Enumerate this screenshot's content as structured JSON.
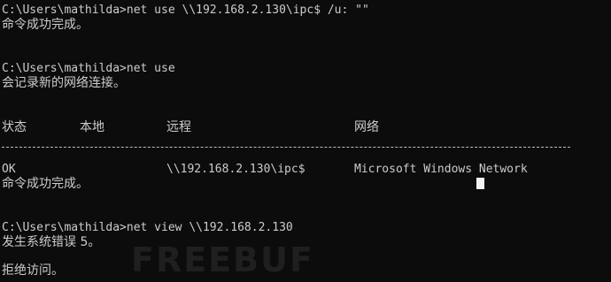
{
  "terminal": {
    "cmd1": "C:\\Users\\mathilda>net use \\\\192.168.2.130\\ipc$ /u: \"\"",
    "out1": "命令成功完成。",
    "cmd2": "C:\\Users\\mathilda>net use",
    "out2": "会记录新的网络连接。",
    "table": {
      "headers": [
        "状态",
        "本地",
        "远程",
        "网络"
      ],
      "separator": "-------------------------------------------------------------------------------",
      "row": {
        "status": "OK",
        "local": "",
        "remote": "\\\\192.168.2.130\\ipc$",
        "network": "Microsoft Windows Network"
      }
    },
    "out3": "命令成功完成。",
    "cmd3": "C:\\Users\\mathilda>net view \\\\192.168.2.130",
    "out4": "发生系统错误 5。",
    "out5": "拒绝访问。"
  },
  "watermark": "FREEBUF"
}
